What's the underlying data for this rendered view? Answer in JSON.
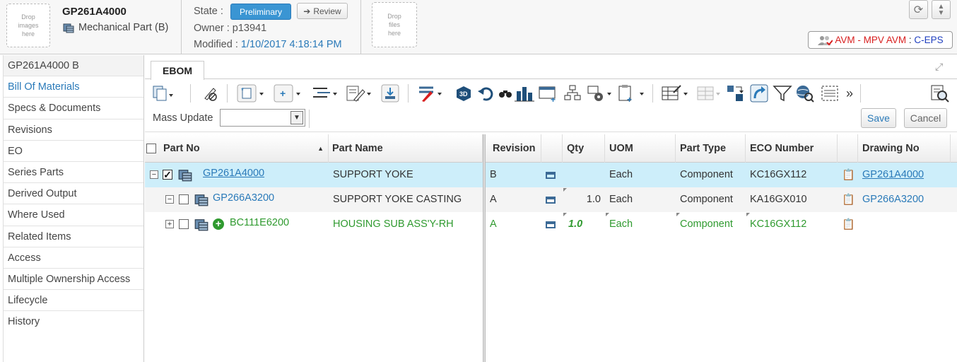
{
  "header": {
    "drop_images": "Drop images here",
    "drop_files": "Drop files here",
    "part_number": "GP261A4000",
    "part_type": "Mechanical Part (B)",
    "state_label": "State :",
    "state_value": "Preliminary",
    "review_button": "Review",
    "owner": "Owner : p13941",
    "modified_label": "Modified :",
    "modified_value": "1/10/2017 4:18:14 PM",
    "avm_badge": {
      "part1": "AVM - MPV AVM",
      "sep": " : ",
      "part2": "C-EPS"
    }
  },
  "nav": {
    "items": [
      "GP261A4000 B",
      "Bill Of Materials",
      "Specs & Documents",
      "Revisions",
      "EO",
      "Series Parts",
      "Derived Output",
      "Where Used",
      "Related Items",
      "Access",
      "Multiple Ownership Access",
      "Lifecycle",
      "History"
    ],
    "active_index": 1
  },
  "tabs": {
    "ebom": "EBOM"
  },
  "massupdate": {
    "label": "Mass Update",
    "select_value": ""
  },
  "actions": {
    "save": "Save",
    "cancel": "Cancel"
  },
  "grid": {
    "headers": {
      "part_no": "Part No",
      "part_name": "Part Name",
      "revision": "Revision",
      "qty": "Qty",
      "uom": "UOM",
      "part_type": "Part Type",
      "eco_number": "ECO Number",
      "drawing_no": "Drawing No"
    },
    "rows": [
      {
        "part_no": "GP261A4000",
        "part_name": "SUPPORT YOKE",
        "revision": "B",
        "qty": "",
        "uom": "Each",
        "part_type": "Component",
        "eco_number": "KC16GX112",
        "drawing_no": "GP261A4000"
      },
      {
        "part_no": "GP266A3200",
        "part_name": "SUPPORT YOKE CASTING",
        "revision": "A",
        "qty": "1.0",
        "uom": "Each",
        "part_type": "Component",
        "eco_number": "KA16GX010",
        "drawing_no": "GP266A3200"
      },
      {
        "part_no": "BC111E6200",
        "part_name": "HOUSING SUB ASS'Y-RH",
        "revision": "A",
        "qty": "1.0",
        "uom": "Each",
        "part_type": "Component",
        "eco_number": "KC16GX112",
        "drawing_no": ""
      }
    ]
  },
  "colors": {
    "accent": "#2a7ab9",
    "selected_row": "#cdeefa",
    "new_item": "#2f9a2f",
    "badge_red": "#d81e1e",
    "badge_blue": "#1f3fbf"
  }
}
